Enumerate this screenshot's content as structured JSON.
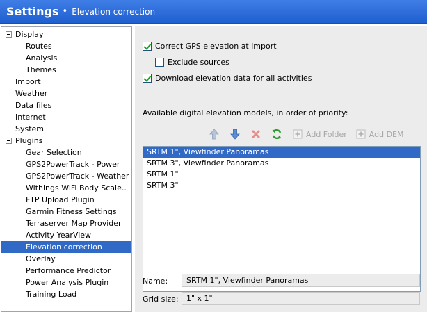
{
  "title": {
    "main": "Settings",
    "separator": "•",
    "sub": "Elevation correction"
  },
  "tree": {
    "items": [
      {
        "label": "Display",
        "level": 0,
        "expander": true
      },
      {
        "label": "Routes",
        "level": 1
      },
      {
        "label": "Analysis",
        "level": 1
      },
      {
        "label": "Themes",
        "level": 1
      },
      {
        "label": "Import",
        "level": 0
      },
      {
        "label": "Weather",
        "level": 0
      },
      {
        "label": "Data files",
        "level": 0
      },
      {
        "label": "Internet",
        "level": 0
      },
      {
        "label": "System",
        "level": 0
      },
      {
        "label": "Plugins",
        "level": 0,
        "expander": true
      },
      {
        "label": "Gear Selection",
        "level": 1
      },
      {
        "label": "GPS2PowerTrack - Power",
        "level": 1
      },
      {
        "label": "GPS2PowerTrack - Weather",
        "level": 1
      },
      {
        "label": "Withings WiFi Body Scale..",
        "level": 1
      },
      {
        "label": "FTP Upload Plugin",
        "level": 1
      },
      {
        "label": "Garmin Fitness Settings",
        "level": 1
      },
      {
        "label": "Terraserver Map Provider",
        "level": 1
      },
      {
        "label": "Activity YearView",
        "level": 1
      },
      {
        "label": "Elevation correction",
        "level": 1,
        "selected": true
      },
      {
        "label": "Overlay",
        "level": 1
      },
      {
        "label": "Performance Predictor",
        "level": 1
      },
      {
        "label": "Power Analysis Plugin",
        "level": 1
      },
      {
        "label": "Training Load",
        "level": 1
      }
    ]
  },
  "options": {
    "correct_gps": {
      "label": "Correct GPS elevation at import",
      "checked": true
    },
    "exclude_sources": {
      "label": "Exclude sources",
      "checked": false
    },
    "download_elevation": {
      "label": "Download elevation data for all activities",
      "checked": true
    }
  },
  "models_heading": "Available digital elevation models, in order of priority:",
  "toolbar": {
    "move_up": {
      "icon": "arrow-up-icon"
    },
    "move_down": {
      "icon": "arrow-down-icon"
    },
    "remove": {
      "icon": "delete-x-icon"
    },
    "refresh": {
      "icon": "refresh-icon"
    },
    "add_folder": {
      "label": "Add Folder",
      "icon": "add-folder-icon"
    },
    "add_dem": {
      "label": "Add DEM",
      "icon": "add-dem-icon"
    }
  },
  "models": [
    {
      "label": "SRTM 1\", Viewfinder Panoramas",
      "selected": true
    },
    {
      "label": "SRTM 3\", Viewfinder Panoramas"
    },
    {
      "label": "SRTM 1\""
    },
    {
      "label": "SRTM 3\""
    }
  ],
  "details": {
    "name_label": "Name:",
    "name_value": "SRTM 1\", Viewfinder Panoramas",
    "grid_label": "Grid size:",
    "grid_value": "1\" x 1\""
  },
  "colors": {
    "title_bar": "#2b6ad8",
    "selection": "#3169c6",
    "panel_bg": "#ececec"
  }
}
